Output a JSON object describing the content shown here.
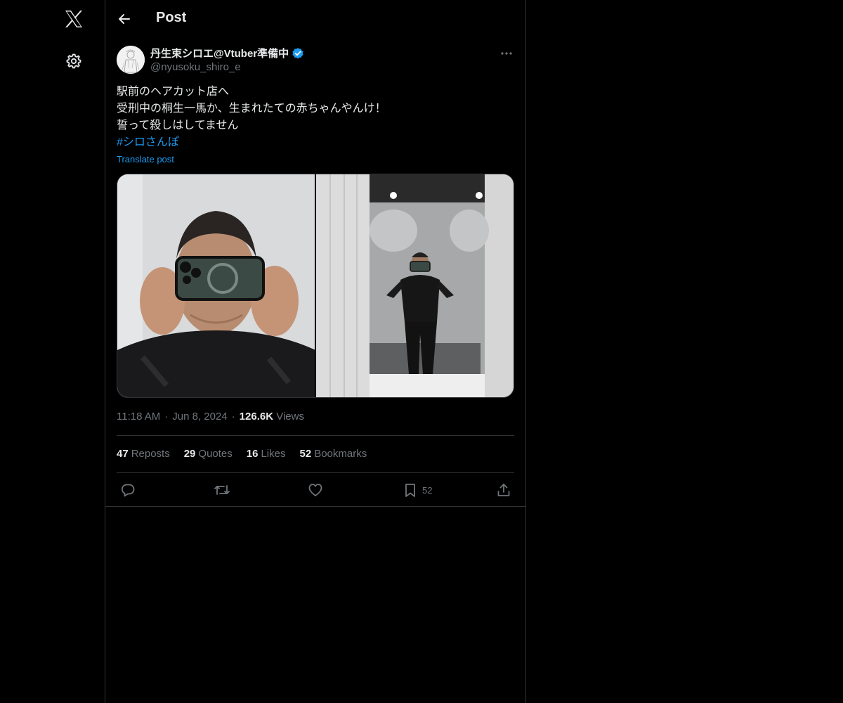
{
  "nav": {
    "logo_icon": "x-logo-icon",
    "settings_icon": "gear-icon"
  },
  "header": {
    "title": "Post"
  },
  "post": {
    "author_name": "丹生束シロエ@Vtuber準備中",
    "author_handle": "@nyusoku_shiro_e",
    "text_lines": [
      "駅前のヘアカット店へ",
      "受刑中の桐生一馬か、生まれたての赤ちゃんやんけ！",
      "誓って殺しはしてません"
    ],
    "hashtag": "#シロさんぽ",
    "translate_label": "Translate post",
    "time": "11:18 AM",
    "date": "Jun 8, 2024",
    "views_count": "126.6K",
    "views_label": "Views",
    "separator": "·"
  },
  "stats": {
    "reposts_count": "47",
    "reposts_label": "Reposts",
    "quotes_count": "29",
    "quotes_label": "Quotes",
    "likes_count": "16",
    "likes_label": "Likes",
    "bookmarks_count": "52",
    "bookmarks_label": "Bookmarks"
  },
  "actions": {
    "bookmark_count": "52"
  },
  "colors": {
    "background": "#000000",
    "text": "#e7e9ea",
    "muted": "#71767b",
    "accent": "#1d9bf0",
    "border": "#2f3336"
  }
}
